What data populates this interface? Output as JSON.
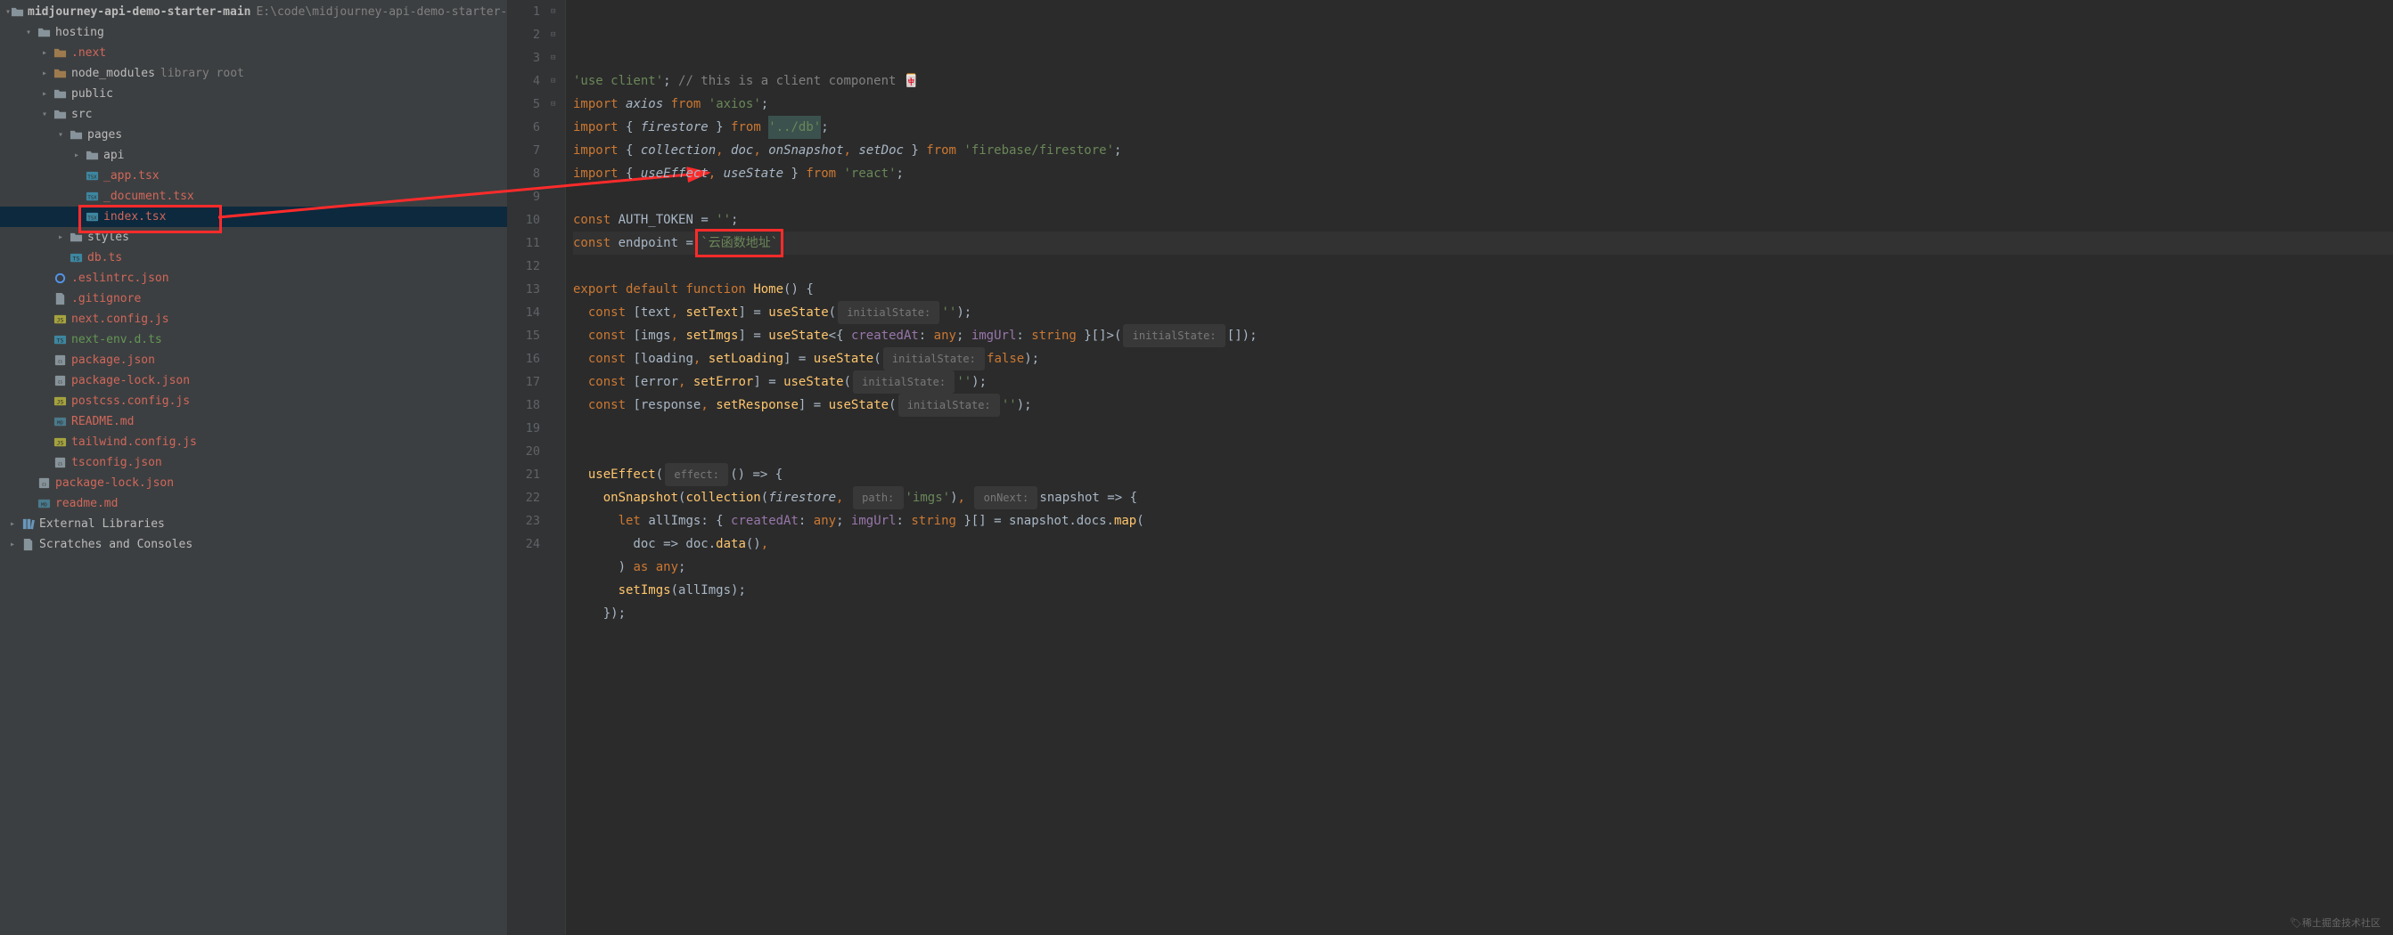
{
  "project": {
    "name": "midjourney-api-demo-starter-main",
    "path": "E:\\code\\midjourney-api-demo-starter-"
  },
  "tree": [
    {
      "depth": 0,
      "chev": "down",
      "icon": "folder",
      "label": "midjourney-api-demo-starter-main",
      "cls": "bold",
      "suffix": "E:\\code\\midjourney-api-demo-starter-"
    },
    {
      "depth": 1,
      "chev": "down",
      "icon": "folder",
      "label": "hosting",
      "cls": ""
    },
    {
      "depth": 2,
      "chev": "right",
      "icon": "folder-excl",
      "label": ".next",
      "cls": "modified"
    },
    {
      "depth": 2,
      "chev": "right",
      "icon": "folder-excl",
      "label": "node_modules",
      "cls": "",
      "suffix": "library root"
    },
    {
      "depth": 2,
      "chev": "right",
      "icon": "folder",
      "label": "public",
      "cls": ""
    },
    {
      "depth": 2,
      "chev": "down",
      "icon": "folder",
      "label": "src",
      "cls": ""
    },
    {
      "depth": 3,
      "chev": "down",
      "icon": "folder",
      "label": "pages",
      "cls": ""
    },
    {
      "depth": 4,
      "chev": "right",
      "icon": "folder",
      "label": "api",
      "cls": ""
    },
    {
      "depth": 4,
      "chev": "",
      "icon": "tsx",
      "label": "_app.tsx",
      "cls": "modified"
    },
    {
      "depth": 4,
      "chev": "",
      "icon": "tsx",
      "label": "_document.tsx",
      "cls": "modified"
    },
    {
      "depth": 4,
      "chev": "",
      "icon": "tsx",
      "label": "index.tsx",
      "cls": "modified",
      "selected": true,
      "redbox": true
    },
    {
      "depth": 3,
      "chev": "right",
      "icon": "folder",
      "label": "styles",
      "cls": ""
    },
    {
      "depth": 3,
      "chev": "",
      "icon": "ts",
      "label": "db.ts",
      "cls": "modified"
    },
    {
      "depth": 2,
      "chev": "",
      "icon": "circle",
      "label": ".eslintrc.json",
      "cls": "modified"
    },
    {
      "depth": 2,
      "chev": "",
      "icon": "file",
      "label": ".gitignore",
      "cls": "modified"
    },
    {
      "depth": 2,
      "chev": "",
      "icon": "js",
      "label": "next.config.js",
      "cls": "modified"
    },
    {
      "depth": 2,
      "chev": "",
      "icon": "ts",
      "label": "next-env.d.ts",
      "cls": "untracked"
    },
    {
      "depth": 2,
      "chev": "",
      "icon": "json",
      "label": "package.json",
      "cls": "modified"
    },
    {
      "depth": 2,
      "chev": "",
      "icon": "json",
      "label": "package-lock.json",
      "cls": "modified"
    },
    {
      "depth": 2,
      "chev": "",
      "icon": "js",
      "label": "postcss.config.js",
      "cls": "modified"
    },
    {
      "depth": 2,
      "chev": "",
      "icon": "md",
      "label": "README.md",
      "cls": "modified"
    },
    {
      "depth": 2,
      "chev": "",
      "icon": "js",
      "label": "tailwind.config.js",
      "cls": "modified"
    },
    {
      "depth": 2,
      "chev": "",
      "icon": "json",
      "label": "tsconfig.json",
      "cls": "modified"
    },
    {
      "depth": 1,
      "chev": "",
      "icon": "json",
      "label": "package-lock.json",
      "cls": "modified"
    },
    {
      "depth": 1,
      "chev": "",
      "icon": "md",
      "label": "readme.md",
      "cls": "modified"
    },
    {
      "depth": 0,
      "chev": "right",
      "icon": "lib",
      "label": "External Libraries",
      "cls": ""
    },
    {
      "depth": 0,
      "chev": "right",
      "icon": "file",
      "label": "Scratches and Consoles",
      "cls": ""
    }
  ],
  "code": {
    "lines": [
      {
        "n": 1,
        "fold": "",
        "tokens": [
          [
            "string",
            "'use client'"
          ],
          [
            "default",
            "; "
          ],
          [
            "comment",
            "// this is a client component 🀄"
          ]
        ]
      },
      {
        "n": 2,
        "fold": "⌐",
        "tokens": [
          [
            "keyword",
            "import"
          ],
          [
            "default",
            " "
          ],
          [
            "import-name",
            "axios"
          ],
          [
            "default",
            " "
          ],
          [
            "keyword",
            "from"
          ],
          [
            "default",
            " "
          ],
          [
            "string",
            "'axios'"
          ],
          [
            "default",
            ";"
          ]
        ]
      },
      {
        "n": 3,
        "fold": "",
        "tokens": [
          [
            "keyword",
            "import"
          ],
          [
            "default",
            " { "
          ],
          [
            "import-name",
            "firestore"
          ],
          [
            "default",
            " } "
          ],
          [
            "keyword",
            "from"
          ],
          [
            "default",
            " "
          ],
          [
            "string-bg",
            "'../db'"
          ],
          [
            "default",
            ";"
          ]
        ]
      },
      {
        "n": 4,
        "fold": "",
        "tokens": [
          [
            "keyword",
            "import"
          ],
          [
            "default",
            " { "
          ],
          [
            "import-name",
            "collection"
          ],
          [
            "punct",
            ","
          ],
          [
            "default",
            " "
          ],
          [
            "import-name",
            "doc"
          ],
          [
            "punct",
            ","
          ],
          [
            "default",
            " "
          ],
          [
            "import-name",
            "onSnapshot"
          ],
          [
            "punct",
            ","
          ],
          [
            "default",
            " "
          ],
          [
            "import-name",
            "setDoc"
          ],
          [
            "default",
            " } "
          ],
          [
            "keyword",
            "from"
          ],
          [
            "default",
            " "
          ],
          [
            "string",
            "'firebase/firestore'"
          ],
          [
            "default",
            ";"
          ]
        ]
      },
      {
        "n": 5,
        "fold": "⌙",
        "tokens": [
          [
            "keyword",
            "import"
          ],
          [
            "default",
            " { "
          ],
          [
            "import-name",
            "useEffect"
          ],
          [
            "punct",
            ","
          ],
          [
            "default",
            " "
          ],
          [
            "import-name",
            "useState"
          ],
          [
            "default",
            " } "
          ],
          [
            "keyword",
            "from"
          ],
          [
            "default",
            " "
          ],
          [
            "string",
            "'react'"
          ],
          [
            "default",
            ";"
          ]
        ]
      },
      {
        "n": 6,
        "fold": "",
        "tokens": []
      },
      {
        "n": 7,
        "fold": "",
        "tokens": [
          [
            "keyword",
            "const"
          ],
          [
            "default",
            " AUTH_TOKEN "
          ],
          [
            "default",
            "= "
          ],
          [
            "string",
            "''"
          ],
          [
            "default",
            ";"
          ]
        ]
      },
      {
        "n": 8,
        "fold": "",
        "cursor": true,
        "tokens": [
          [
            "keyword",
            "const"
          ],
          [
            "default",
            " endpoint "
          ],
          [
            "default",
            "= "
          ],
          [
            "string-redbox",
            "`云函数地址`"
          ],
          [
            "default",
            ";"
          ]
        ]
      },
      {
        "n": 9,
        "fold": "",
        "tokens": []
      },
      {
        "n": 10,
        "fold": "⌐",
        "tokens": [
          [
            "keyword",
            "export default function"
          ],
          [
            "default",
            " "
          ],
          [
            "func",
            "Home"
          ],
          [
            "default",
            "() {"
          ]
        ]
      },
      {
        "n": 11,
        "fold": "",
        "tokens": [
          [
            "default",
            "  "
          ],
          [
            "keyword",
            "const"
          ],
          [
            "default",
            " ["
          ],
          [
            "default",
            "text"
          ],
          [
            "punct",
            ","
          ],
          [
            "default",
            " "
          ],
          [
            "func",
            "setText"
          ],
          [
            "default",
            "] = "
          ],
          [
            "func",
            "useState"
          ],
          [
            "default",
            "("
          ],
          [
            "hint",
            " initialState: "
          ],
          [
            "string",
            "''"
          ],
          [
            "default",
            ");"
          ]
        ]
      },
      {
        "n": 12,
        "fold": "",
        "tokens": [
          [
            "default",
            "  "
          ],
          [
            "keyword",
            "const"
          ],
          [
            "default",
            " ["
          ],
          [
            "default",
            "imgs"
          ],
          [
            "punct",
            ","
          ],
          [
            "default",
            " "
          ],
          [
            "func",
            "setImgs"
          ],
          [
            "default",
            "] = "
          ],
          [
            "func",
            "useState"
          ],
          [
            "default",
            "<{ "
          ],
          [
            "ident",
            "createdAt"
          ],
          [
            "default",
            ": "
          ],
          [
            "keyword",
            "any"
          ],
          [
            "default",
            "; "
          ],
          [
            "ident",
            "imgUrl"
          ],
          [
            "default",
            ": "
          ],
          [
            "keyword",
            "string"
          ],
          [
            "default",
            " }[]>("
          ],
          [
            "hint",
            " initialState: "
          ],
          [
            "default",
            "[]"
          ],
          [
            "default",
            ");"
          ]
        ]
      },
      {
        "n": 13,
        "fold": "",
        "tokens": [
          [
            "default",
            "  "
          ],
          [
            "keyword",
            "const"
          ],
          [
            "default",
            " ["
          ],
          [
            "default",
            "loading"
          ],
          [
            "punct",
            ","
          ],
          [
            "default",
            " "
          ],
          [
            "func",
            "setLoading"
          ],
          [
            "default",
            "] = "
          ],
          [
            "func",
            "useState"
          ],
          [
            "default",
            "("
          ],
          [
            "hint",
            " initialState: "
          ],
          [
            "keyword",
            "false"
          ],
          [
            "default",
            ");"
          ]
        ]
      },
      {
        "n": 14,
        "fold": "",
        "tokens": [
          [
            "default",
            "  "
          ],
          [
            "keyword",
            "const"
          ],
          [
            "default",
            " ["
          ],
          [
            "default",
            "error"
          ],
          [
            "punct",
            ","
          ],
          [
            "default",
            " "
          ],
          [
            "func",
            "setError"
          ],
          [
            "default",
            "] = "
          ],
          [
            "func",
            "useState"
          ],
          [
            "default",
            "("
          ],
          [
            "hint",
            " initialState: "
          ],
          [
            "string",
            "''"
          ],
          [
            "default",
            ");"
          ]
        ]
      },
      {
        "n": 15,
        "fold": "",
        "tokens": [
          [
            "default",
            "  "
          ],
          [
            "keyword",
            "const"
          ],
          [
            "default",
            " ["
          ],
          [
            "default",
            "response"
          ],
          [
            "punct",
            ","
          ],
          [
            "default",
            " "
          ],
          [
            "func",
            "setResponse"
          ],
          [
            "default",
            "] = "
          ],
          [
            "func",
            "useState"
          ],
          [
            "default",
            "("
          ],
          [
            "hint",
            " initialState: "
          ],
          [
            "string",
            "''"
          ],
          [
            "default",
            ");"
          ]
        ]
      },
      {
        "n": 16,
        "fold": "",
        "tokens": []
      },
      {
        "n": 17,
        "fold": "",
        "tokens": []
      },
      {
        "n": 18,
        "fold": "⌐",
        "tokens": [
          [
            "default",
            "  "
          ],
          [
            "func",
            "useEffect"
          ],
          [
            "default",
            "("
          ],
          [
            "hint",
            " effect: "
          ],
          [
            "default",
            "() => {"
          ]
        ]
      },
      {
        "n": 19,
        "fold": "⌐",
        "tokens": [
          [
            "default",
            "    "
          ],
          [
            "func",
            "onSnapshot"
          ],
          [
            "default",
            "("
          ],
          [
            "func",
            "collection"
          ],
          [
            "default",
            "("
          ],
          [
            "import-name",
            "firestore"
          ],
          [
            "punct",
            ","
          ],
          [
            "default",
            " "
          ],
          [
            "hint",
            " path: "
          ],
          [
            "string",
            "'imgs'"
          ],
          [
            "default",
            ")"
          ],
          [
            "punct",
            ","
          ],
          [
            "default",
            " "
          ],
          [
            "hint",
            " onNext: "
          ],
          [
            "default",
            "snapshot => {"
          ]
        ]
      },
      {
        "n": 20,
        "fold": "",
        "tokens": [
          [
            "default",
            "      "
          ],
          [
            "keyword",
            "let"
          ],
          [
            "default",
            " "
          ],
          [
            "default",
            "allImgs"
          ],
          [
            "default",
            ": { "
          ],
          [
            "ident",
            "createdAt"
          ],
          [
            "default",
            ": "
          ],
          [
            "keyword",
            "any"
          ],
          [
            "default",
            "; "
          ],
          [
            "ident",
            "imgUrl"
          ],
          [
            "default",
            ": "
          ],
          [
            "keyword",
            "string"
          ],
          [
            "default",
            " }[] = snapshot.docs."
          ],
          [
            "func",
            "map"
          ],
          [
            "default",
            "("
          ]
        ]
      },
      {
        "n": 21,
        "fold": "",
        "tokens": [
          [
            "default",
            "        doc => doc."
          ],
          [
            "func",
            "data"
          ],
          [
            "default",
            "()"
          ],
          [
            "punct",
            ","
          ]
        ]
      },
      {
        "n": 22,
        "fold": "",
        "tokens": [
          [
            "default",
            "      ) "
          ],
          [
            "keyword",
            "as any"
          ],
          [
            "default",
            ";"
          ]
        ]
      },
      {
        "n": 23,
        "fold": "",
        "tokens": [
          [
            "default",
            "      "
          ],
          [
            "func",
            "setImgs"
          ],
          [
            "default",
            "(allImgs);"
          ]
        ]
      },
      {
        "n": 24,
        "fold": "",
        "tokens": [
          [
            "default",
            "    });"
          ]
        ]
      }
    ]
  },
  "watermark": "🏷稀土掘金技术社区"
}
